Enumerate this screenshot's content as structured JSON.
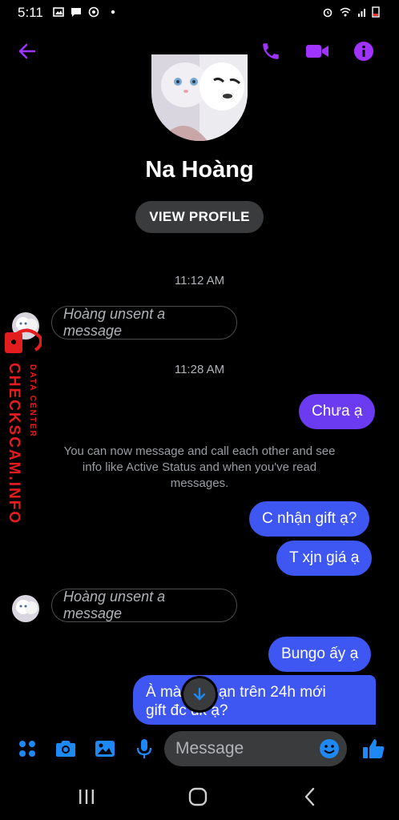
{
  "status_bar": {
    "time": "5:11"
  },
  "contact": {
    "name": "Na Hoàng",
    "view_profile": "VIEW PROFILE"
  },
  "messages": {
    "ts1": "11:12 AM",
    "unsent1": "Hoàng unsent a message",
    "ts2": "11:28 AM",
    "m1": "Chưa ạ",
    "info": "You can now message and call each other and see info like Active Status and when you've read messages.",
    "m2": "C nhận gift ạ?",
    "m3": "T xjn giá ạ",
    "unsent2": "Hoàng unsent a message",
    "m4": "Bungo ấy ạ",
    "m5_line1": "À mà kết bạn trên 24h mới",
    "m5_line2": "gift đc dk ạ?"
  },
  "composer": {
    "placeholder": "Message"
  },
  "watermark": {
    "brand": "CHECKSCAM.INFO",
    "tag": "DATA CENTER"
  },
  "colors": {
    "accent": "#a033ff",
    "bubble_blue": "#3f57f2",
    "bubble_purple": "#6b3bf2",
    "composer_blue": "#1e88f5"
  }
}
